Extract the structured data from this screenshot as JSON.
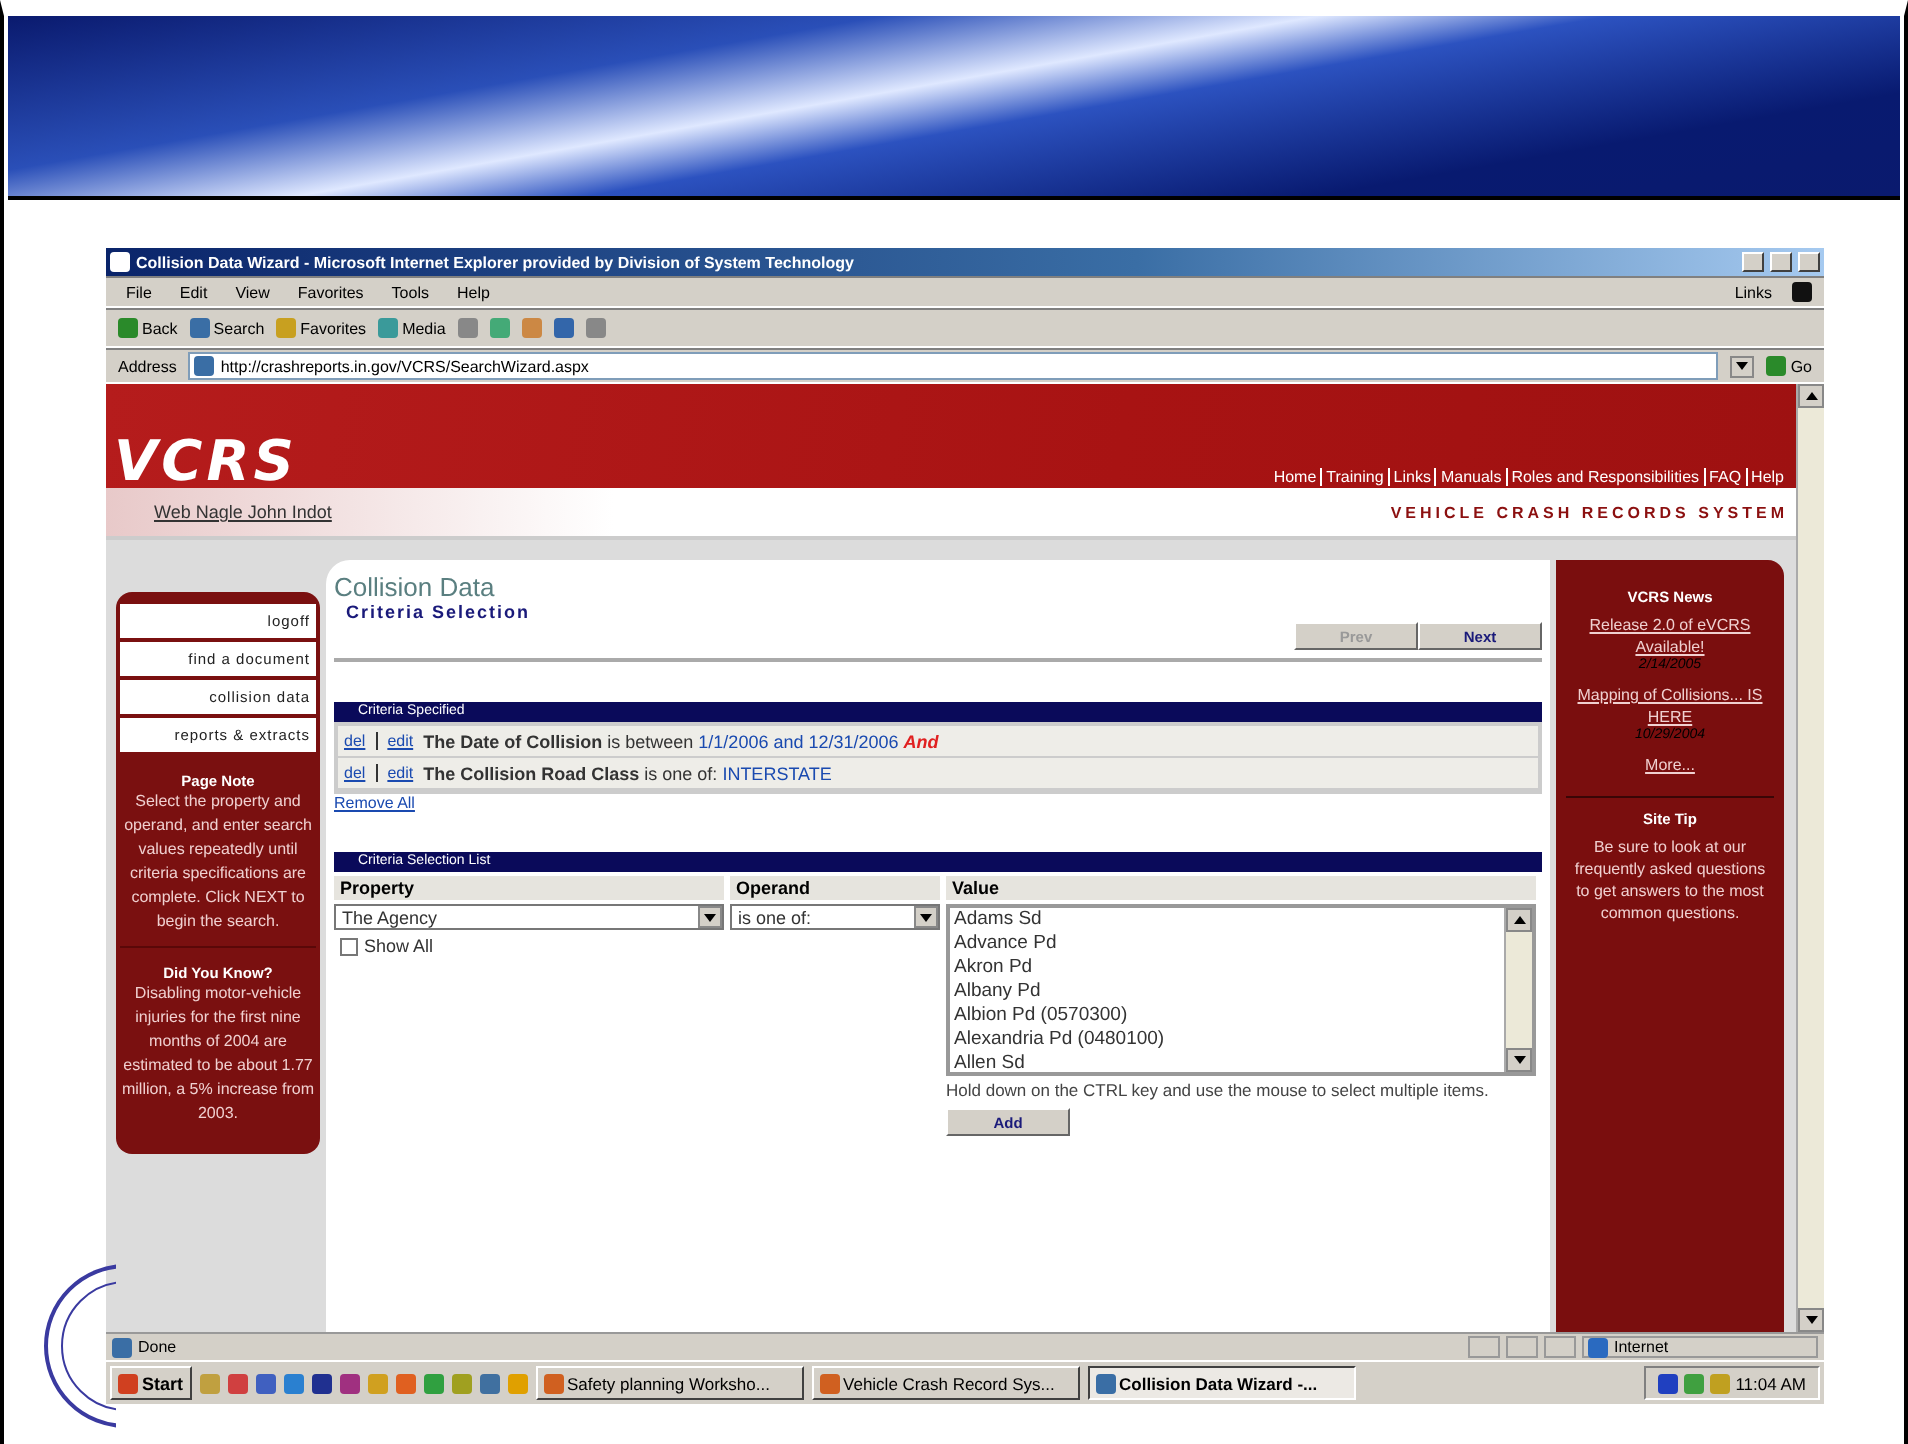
{
  "browser": {
    "title": "Collision Data Wizard - Microsoft Internet Explorer provided by Division of System Technology",
    "menu": [
      "File",
      "Edit",
      "View",
      "Favorites",
      "Tools",
      "Help"
    ],
    "links_label": "Links",
    "toolbar": [
      {
        "label": "Back",
        "kind": "back"
      },
      {
        "label": "Search",
        "kind": "search"
      },
      {
        "label": "Favorites",
        "kind": "favorites"
      },
      {
        "label": "Media",
        "kind": "media"
      }
    ],
    "address_label": "Address",
    "url": "http://crashreports.in.gov/VCRS/SearchWizard.aspx",
    "go": "Go"
  },
  "site": {
    "logo": "VCRS",
    "nav": [
      "Home",
      "Training",
      "Links",
      "Manuals",
      "Roles and Responsibilities",
      "FAQ",
      "Help"
    ],
    "user": "Web Nagle John Indot",
    "tagline": "VEHICLE CRASH RECORDS SYSTEM"
  },
  "sidebar": {
    "items": [
      "logoff",
      "find a document",
      "collision data",
      "reports & extracts"
    ],
    "notes": [
      {
        "title": "Page Note",
        "text": "Select the property and operand, and enter search values repeatedly until criteria specifications are complete. Click NEXT to begin the search."
      },
      {
        "title": "Did You Know?",
        "text": "Disabling motor-vehicle injuries for the first nine months of 2004 are estimated to be about 1.77 million, a 5% increase from 2003."
      }
    ]
  },
  "page": {
    "title": "Collision Data",
    "subtitle": "Criteria Selection",
    "prev": {
      "label": "Prev",
      "disabled": true
    },
    "next": {
      "label": "Next",
      "disabled": false
    },
    "criteria_header": "Criteria Specified",
    "criteria": [
      {
        "del": "del",
        "edit": "edit",
        "field": "The Date of Collision",
        "op": "is between",
        "value": "1/1/2006 and 12/31/2006",
        "conj": "And"
      },
      {
        "del": "del",
        "edit": "edit",
        "field": "The Collision Road Class",
        "op": "is one of:",
        "value": "INTERSTATE"
      }
    ],
    "remove_all": "Remove All",
    "list_header": "Criteria Selection List",
    "columns": [
      "Property",
      "Operand",
      "Value"
    ],
    "property": "The Agency",
    "show_all": {
      "label": "Show All",
      "checked": false
    },
    "operand": "is one of:",
    "values": [
      "Adams Sd",
      "Advance Pd",
      "Akron Pd",
      "Albany Pd",
      "Albion Pd (0570300)",
      "Alexandria Pd (0480100)",
      "Allen Sd"
    ],
    "hint": "Hold down on the CTRL key and use the mouse to select multiple items.",
    "add": "Add"
  },
  "news": {
    "title": "VCRS News",
    "items": [
      {
        "link": "Release 2.0 of eVCRS Available!",
        "date": "2/14/2005"
      },
      {
        "link": "Mapping of Collisions... IS HERE",
        "date": "10/29/2004"
      }
    ],
    "more": "More...",
    "tip_title": "Site Tip",
    "tip": "Be sure to look at our frequently asked questions to get answers to the most common questions."
  },
  "status": {
    "text": "Done",
    "zone": "Internet"
  },
  "taskbar": {
    "start": "Start",
    "tasks": [
      {
        "label": "Safety planning Worksho...",
        "selected": false
      },
      {
        "label": "Vehicle Crash Record Sys...",
        "selected": false
      },
      {
        "label": "Collision Data Wizard -...",
        "selected": true
      }
    ],
    "time": "11:04 AM"
  }
}
